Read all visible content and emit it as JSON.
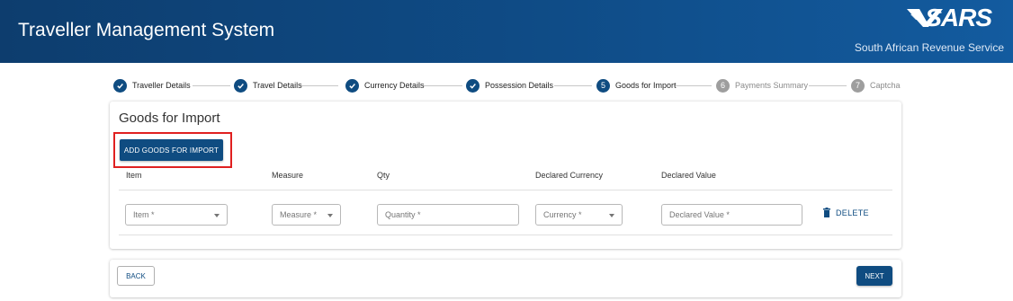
{
  "header": {
    "title": "Traveller Management System",
    "logo_text": "SARS",
    "org_name": "South African Revenue Service",
    "logo_icon": "sars-logo-mark"
  },
  "stepper": {
    "steps": [
      {
        "label": "Traveller Details",
        "status": "complete",
        "marker": ""
      },
      {
        "label": "Travel Details",
        "status": "complete",
        "marker": ""
      },
      {
        "label": "Currency Details",
        "status": "complete",
        "marker": ""
      },
      {
        "label": "Possession Details",
        "status": "complete",
        "marker": ""
      },
      {
        "label": "Goods for Import",
        "status": "active",
        "marker": "5"
      },
      {
        "label": "Payments Summary",
        "status": "pending",
        "marker": "6"
      },
      {
        "label": "Captcha",
        "status": "pending",
        "marker": "7"
      }
    ],
    "complete_icon": "check-icon"
  },
  "goods": {
    "title": "Goods for Import",
    "add_button_label": "ADD GOODS FOR IMPORT",
    "columns": [
      "Item",
      "Measure",
      "Qty",
      "Declared Currency",
      "Declared Value"
    ],
    "row": {
      "item_label": "Item *",
      "measure_label": "Measure *",
      "quantity_label": "Quantity *",
      "currency_label": "Currency *",
      "declared_value_label": "Declared Value *",
      "delete_label": "DELETE",
      "delete_icon": "trash-icon"
    }
  },
  "footer": {
    "back_label": "BACK",
    "next_label": "NEXT"
  },
  "colors": {
    "brand": "#0f4c81",
    "header_dark": "#0d3d6e",
    "pending": "#9e9e9e",
    "highlight": "#e02020"
  }
}
